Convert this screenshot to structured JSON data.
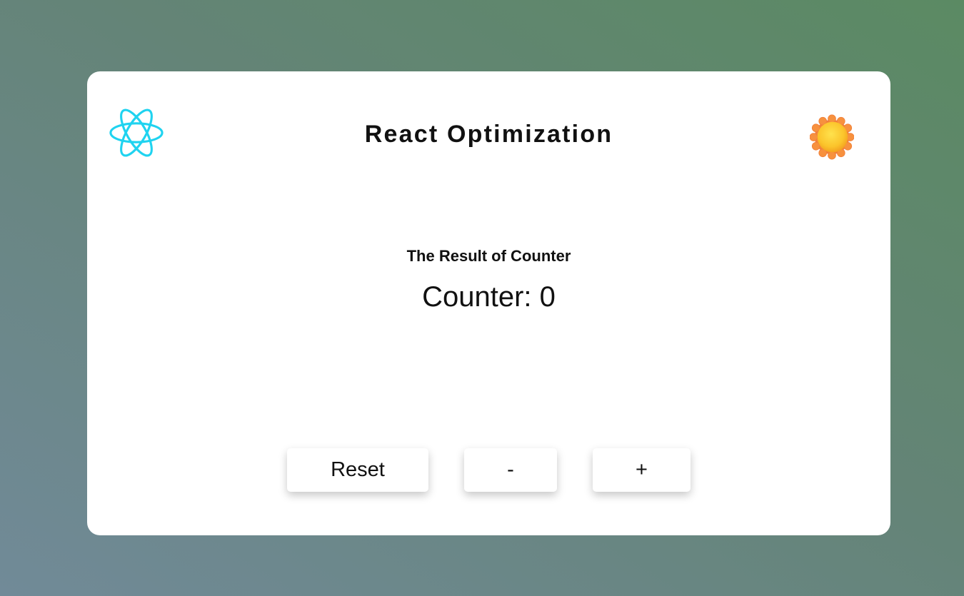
{
  "header": {
    "title": "React Optimization",
    "logo_icon": "react-atom-icon",
    "theme_icon": "sun-icon"
  },
  "counter": {
    "subtitle": "The Result of Counter",
    "label": "Counter: ",
    "value": "0"
  },
  "controls": {
    "reset_label": "Reset",
    "decrement_label": "-",
    "increment_label": "+"
  },
  "colors": {
    "react_cyan": "#1fd3f0",
    "sun_outer": "#f5883a",
    "sun_inner": "#fdd33d",
    "card": "#ffffff"
  }
}
